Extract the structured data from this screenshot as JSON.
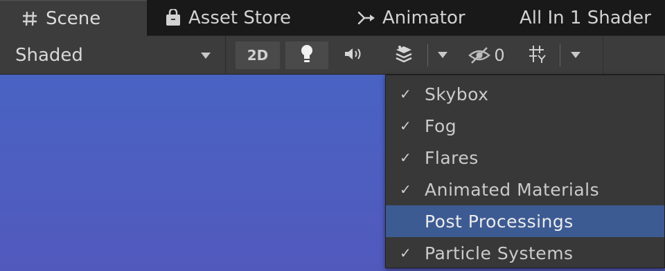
{
  "tabs": [
    {
      "label": "Scene",
      "icon": "hash-grid-icon",
      "active": true
    },
    {
      "label": "Asset Store",
      "icon": "shopping-bag-icon",
      "active": false
    },
    {
      "label": "Animator",
      "icon": "animator-icon",
      "active": false
    },
    {
      "label": "All In 1 Shader",
      "icon": "",
      "active": false
    }
  ],
  "toolbar": {
    "shading_mode": "Shaded",
    "two_d_label": "2D",
    "hidden_count": "0",
    "icons": {
      "lighting": "lightbulb-icon",
      "audio": "speaker-icon",
      "effects": "effects-icon",
      "hidden": "eye-slash-icon",
      "gizmos": "gizmo-grid-icon"
    }
  },
  "effects_menu": {
    "items": [
      {
        "label": "Skybox",
        "checked": true,
        "check_glyph": "✓",
        "highlighted": false
      },
      {
        "label": "Fog",
        "checked": true,
        "check_glyph": "✓",
        "highlighted": false
      },
      {
        "label": "Flares",
        "checked": true,
        "check_glyph": "✓",
        "highlighted": false
      },
      {
        "label": "Animated Materials",
        "checked": true,
        "check_glyph": "✓",
        "highlighted": false
      },
      {
        "label": "Post Processings",
        "checked": false,
        "check_glyph": "",
        "highlighted": true
      },
      {
        "label": "Particle Systems",
        "checked": true,
        "check_glyph": "✓",
        "highlighted": false
      }
    ]
  },
  "colors": {
    "viewport_top": "#4963c3",
    "viewport_bottom": "#5259bd",
    "menu_highlight": "#3d5b93"
  }
}
